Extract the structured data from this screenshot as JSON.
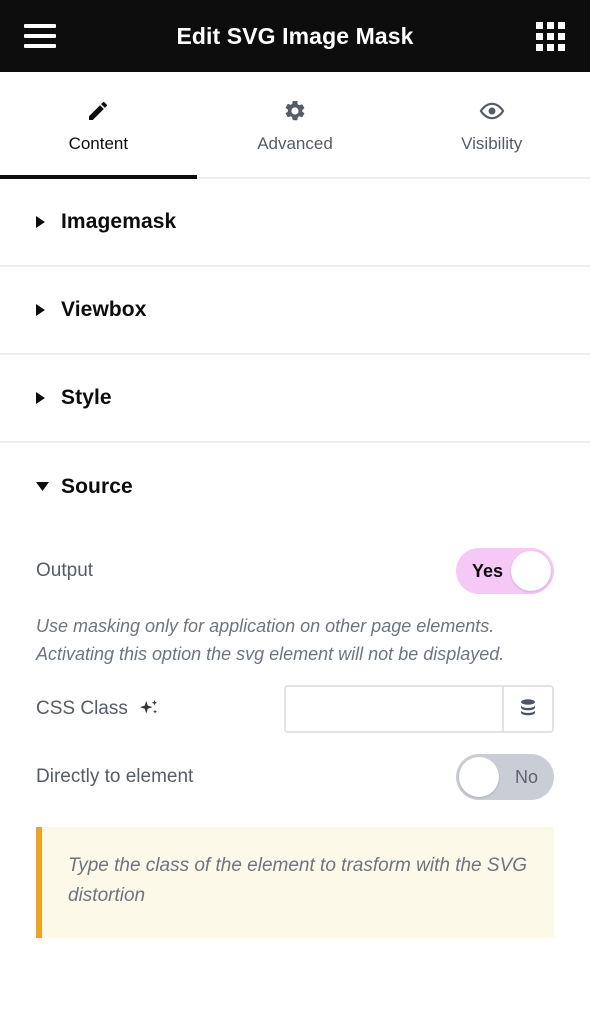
{
  "topbar": {
    "menu_icon": "hamburger-menu-icon",
    "title": "Edit SVG Image Mask",
    "apps_icon": "grid-apps-icon"
  },
  "tabs": [
    {
      "label": "Content",
      "icon": "pencil-icon",
      "active": true
    },
    {
      "label": "Advanced",
      "icon": "gear-icon",
      "active": false
    },
    {
      "label": "Visibility",
      "icon": "eye-icon",
      "active": false
    }
  ],
  "sections": [
    {
      "title": "Imagemask",
      "expanded": false
    },
    {
      "title": "Viewbox",
      "expanded": false
    },
    {
      "title": "Style",
      "expanded": false
    },
    {
      "title": "Source",
      "expanded": true
    }
  ],
  "source": {
    "output": {
      "label": "Output",
      "value": "Yes",
      "state": "on",
      "hint": "Use masking only for application on other page elements. Activating this option the svg element will not be displayed."
    },
    "css_class": {
      "label": "CSS Class",
      "sparkle_icon": "sparkle-ai-icon",
      "value": "",
      "placeholder": "",
      "dynamic_icon": "database-stack-icon"
    },
    "directly_to_element": {
      "label": "Directly to element",
      "value": "No",
      "state": "off"
    },
    "notice": {
      "text": "Type the class of the element to trasform with the SVG distortion"
    }
  },
  "colors": {
    "topbar_bg": "#0d0d0d",
    "active_tab": "#0d0d0d",
    "inactive_text": "#565c66",
    "toggle_on_bg": "#f5c8f5",
    "toggle_off_bg": "#c9ced6",
    "notice_bg": "#fdf9e9",
    "notice_accent": "#f0a223",
    "divider": "#eceef0"
  }
}
